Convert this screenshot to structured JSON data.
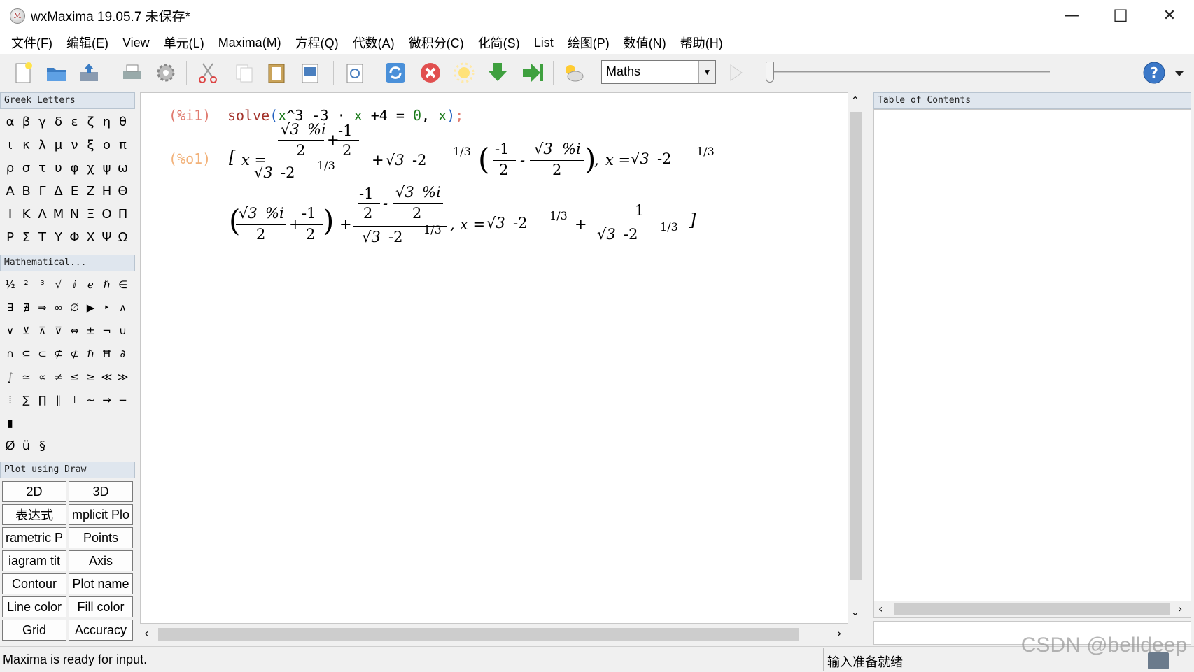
{
  "window": {
    "title": "wxMaxima 19.05.7 未保存*",
    "app_icon_glyph": "M",
    "minimize_glyph": "—",
    "maximize_glyph": "☐",
    "close_glyph": "✕"
  },
  "menu": [
    "文件(F)",
    "编辑(E)",
    "View",
    "单元(L)",
    "Maxima(M)",
    "方程(Q)",
    "代数(A)",
    "微积分(C)",
    "化简(S)",
    "List",
    "绘图(P)",
    "数值(N)",
    "帮助(H)"
  ],
  "toolbar": {
    "cell_type": "Maths",
    "icons": [
      "new-document-icon",
      "open-folder-icon",
      "save-icon",
      "print-icon",
      "settings-icon",
      "cut-icon",
      "copy-icon",
      "paste-icon",
      "select-all-icon",
      "find-icon",
      "restart-icon",
      "interrupt-icon",
      "sun-icon",
      "download-icon",
      "forward-icon",
      "weather-icon",
      "play-icon",
      "help-icon"
    ]
  },
  "sidebar": {
    "greek_title": "Greek Letters",
    "greek": [
      "α",
      "β",
      "γ",
      "δ",
      "ε",
      "ζ",
      "η",
      "θ",
      "ι",
      "κ",
      "λ",
      "μ",
      "ν",
      "ξ",
      "ο",
      "π",
      "ρ",
      "σ",
      "τ",
      "υ",
      "φ",
      "χ",
      "ψ",
      "ω",
      "Α",
      "Β",
      "Γ",
      "Δ",
      "Ε",
      "Ζ",
      "Η",
      "Θ",
      "Ι",
      "Κ",
      "Λ",
      "Μ",
      "Ν",
      "Ξ",
      "Ο",
      "Π",
      "Ρ",
      "Σ",
      "Τ",
      "Υ",
      "Φ",
      "Χ",
      "Ψ",
      "Ω"
    ],
    "math_title": "Mathematical...",
    "math_symbols": [
      "½",
      "²",
      "³",
      "√",
      "ⅈ",
      "ℯ",
      "ℏ",
      "∈",
      "∃",
      "∄",
      "⇒",
      "∞",
      "∅",
      "▶",
      "‣",
      "∧",
      "∨",
      "⊻",
      "⊼",
      "⊽",
      "⇔",
      "±",
      "¬",
      "∪",
      "∩",
      "⊆",
      "⊂",
      "⊈",
      "⊄",
      "ℏ",
      "Ħ",
      "∂",
      "∫",
      "≃",
      "∝",
      "≠",
      "≤",
      "≥",
      "≪",
      "≫",
      "⦙",
      "∑",
      "∏",
      "∥",
      "⊥",
      "∼",
      "→",
      "−",
      "▮"
    ],
    "extra_symbols": [
      "Ø",
      "ü",
      "§"
    ],
    "plot_title": "Plot using Draw",
    "plot_buttons": [
      "2D",
      "3D",
      "表达式",
      "mplicit Plo",
      "rametric P",
      "Points",
      "iagram tit",
      "Axis",
      "Contour",
      "Plot name",
      "Line color",
      "Fill color",
      "Grid",
      "Accuracy"
    ]
  },
  "worksheet": {
    "input_label": "(%i1)",
    "input_cmd": "solve",
    "input_paren_open": "(",
    "input_var": "x",
    "input_pow": "^3 -3",
    "input_dot": "·",
    "input_var2": "x",
    "input_rest": "+4 = ",
    "input_zero": "0",
    "input_comma": ",",
    "input_var3": "x",
    "input_close": ")",
    "input_semicolon": ";",
    "output_label": "(%o1)",
    "sqrt3": "√3",
    "pct_i": "%i",
    "neg1": "-1",
    "two": "2",
    "one": "1",
    "minus2": "-2",
    "one_third": "1/3",
    "x_eq": "x =",
    "plus": "+",
    "minus": "-",
    "comma": ","
  },
  "right_panel": {
    "title": "Table of Contents"
  },
  "status": {
    "left": "Maxima is ready for input.",
    "right": "输入准备就绪"
  },
  "watermark": "CSDN @belldeep"
}
